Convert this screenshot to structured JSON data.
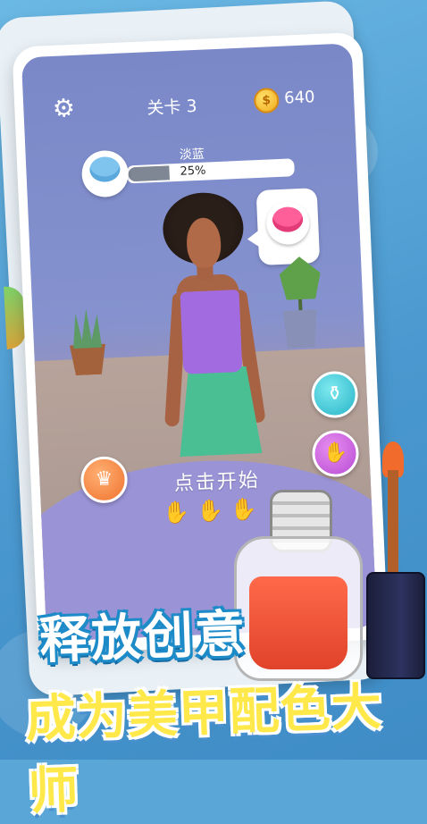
{
  "game": {
    "level_label": "关卡 3",
    "coins": "640",
    "coin_symbol": "$",
    "target_color_name": "淡蓝",
    "progress_text": "25%",
    "progress_value": 0.25,
    "tap_to_start": "点击开始"
  },
  "icons": {
    "settings": "gear-icon",
    "chair": "armchair-icon",
    "bottle": "nail-polish-icon",
    "nail": "nail-icon",
    "hand": "hand-icon"
  },
  "colors": {
    "target_blue": "#7fc4ef",
    "request_pink": "#ff5f98",
    "polish_red": "#e0432a"
  },
  "promo": {
    "headline1": "释放创意",
    "headline2": "成为美甲配色大师"
  }
}
